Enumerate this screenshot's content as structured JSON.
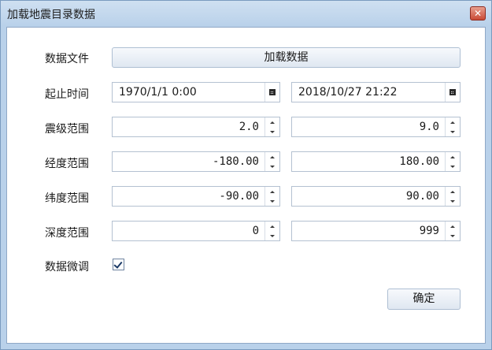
{
  "window": {
    "title": "加载地震目录数据",
    "close_label": "✕"
  },
  "form": {
    "data_file_label": "数据文件",
    "load_button_label": "加载数据",
    "time_label": "起止时间",
    "start_time": "1970/1/1 0:00",
    "end_time": "2018/10/27 21:22",
    "magnitude_label": "震级范围",
    "magnitude_min": "2.0",
    "magnitude_max": "9.0",
    "longitude_label": "经度范围",
    "longitude_min": "-180.00",
    "longitude_max": "180.00",
    "latitude_label": "纬度范围",
    "latitude_min": "-90.00",
    "latitude_max": "90.00",
    "depth_label": "深度范围",
    "depth_min": "0",
    "depth_max": "999",
    "fine_tune_label": "数据微调",
    "fine_tune_checked": true,
    "ok_label": "确定"
  },
  "icons": {
    "calendar": "calendar-icon",
    "spin_up": "arrow-up-icon",
    "spin_down": "arrow-down-icon",
    "close": "close-icon",
    "check": "checkmark-icon"
  },
  "colors": {
    "titlebar": "#b9d1ea",
    "close_button": "#c94a35"
  }
}
